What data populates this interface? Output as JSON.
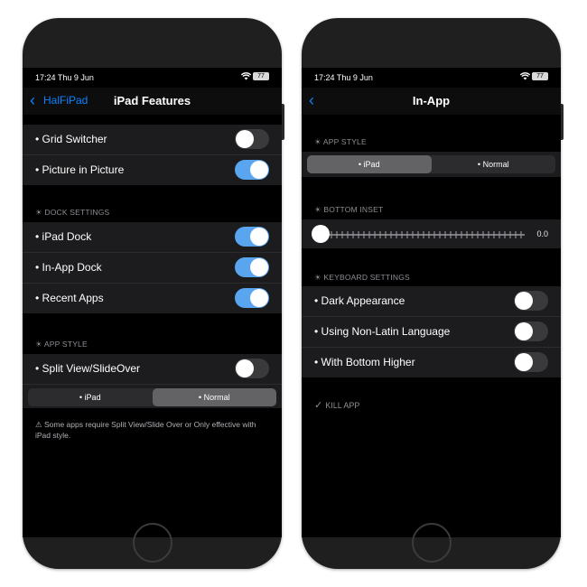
{
  "left": {
    "status": {
      "time": "17:24  Thu 9 Jun",
      "battery": "77"
    },
    "nav": {
      "back_label": "HalFiPad",
      "title": "iPad Features"
    },
    "group1": [
      {
        "label": "• Grid Switcher",
        "on": false
      },
      {
        "label": "• Picture in Picture",
        "on": true
      }
    ],
    "dock_header": "☀ DOCK SETTINGS",
    "group2": [
      {
        "label": "• iPad Dock",
        "on": true
      },
      {
        "label": "• In-App Dock",
        "on": true
      },
      {
        "label": "• Recent Apps",
        "on": true
      }
    ],
    "style_header": "☀ APP STYLE",
    "split": {
      "label": "• Split View/SlideOver",
      "on": false
    },
    "segment": {
      "left": "• iPad",
      "right": "• Normal",
      "selected": "right"
    },
    "note": "⚠ Some apps require Split View/Slide Over or Only effective with iPad style."
  },
  "right": {
    "status": {
      "time": "17:24  Thu 9 Jun",
      "battery": "77"
    },
    "nav": {
      "title": "In-App"
    },
    "style_header": "☀ APP STYLE",
    "segment": {
      "left": "• iPad",
      "right": "• Normal",
      "selected": "left"
    },
    "inset_header": "☀ BOTTOM INSET",
    "inset_value": "0.0",
    "keyboard_header": "☀ KEYBOARD SETTINGS",
    "group": [
      {
        "label": "• Dark Appearance",
        "on": false
      },
      {
        "label": "• Using Non-Latin Language",
        "on": false
      },
      {
        "label": "• With Bottom Higher",
        "on": false
      }
    ],
    "kill_label": "KILL APP"
  }
}
